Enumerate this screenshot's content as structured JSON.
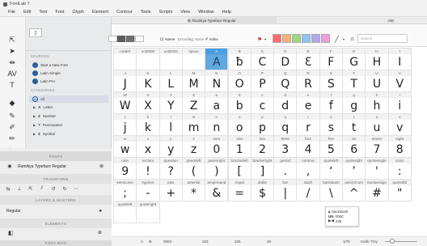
{
  "window": {
    "title": "FontLab 7"
  },
  "menu": [
    "File",
    "Edit",
    "Text",
    "Font",
    "Glyph",
    "Element",
    "Contour",
    "Tools",
    "Scripts",
    "View",
    "Window",
    "Help"
  ],
  "tabs": {
    "dashboard": "Dashboard",
    "font": "Rumikya Typeface Regular",
    "right": "≡/⊟"
  },
  "toolbar": {
    "name_btn": "Name",
    "encoding": "Encoding: None",
    "index_btn": "Index",
    "search_placeholder": "Search"
  },
  "swatches": [
    "#ff6a6a",
    "#ffb07a",
    "#9fd67f",
    "#8fc6ef",
    "#b0a8f2",
    "#f19be0"
  ],
  "panel": {
    "sources_header": "SOURCES",
    "sources": [
      "Start a New Font",
      "Latin Simple",
      "Latin Pro"
    ],
    "categories_header": "CATEGORIES",
    "all_label": "All",
    "categories": [
      {
        "icon": "A",
        "label": "Letter"
      },
      {
        "icon": "2",
        "label": "Number"
      },
      {
        "icon": "?",
        "label": "Punctuation"
      },
      {
        "icon": "Σ",
        "label": "Symbol"
      }
    ]
  },
  "lower": {
    "fonts_header": "FONTS",
    "font_name": "Rumikya Typeface Regular",
    "transform_header": "TRANSFORM",
    "layers_header": "LAYERS & MASTERS",
    "layer_name": "Regular",
    "elements_header": "ELEMENTS",
    "font_info_header": "FONT INFO"
  },
  "grid": {
    "rows": [
      {
        "names": [
          "notdef",
          "uni0000",
          "uni000D",
          "space",
          "A",
          "B",
          "C",
          "D",
          "E",
          "F",
          "G",
          "H",
          "I"
        ],
        "glyphs": [
          "",
          "",
          "",
          "",
          "A",
          "ƀ",
          "С",
          "D",
          "Ɛ",
          "F",
          "G",
          "H",
          "I"
        ]
      },
      {
        "names": [
          "J",
          "K",
          "L",
          "M",
          "N",
          "O",
          "P",
          "Q",
          "R",
          "S",
          "T",
          "U",
          "V"
        ],
        "glyphs": [
          "J",
          "K",
          "L",
          "M",
          "N",
          "O",
          "P",
          "Q",
          "R",
          "S",
          "T",
          "U",
          "V"
        ]
      },
      {
        "names": [
          "W",
          "X",
          "Y",
          "Z",
          "a",
          "b",
          "c",
          "d",
          "e",
          "f",
          "g",
          "h",
          "i"
        ],
        "glyphs": [
          "W",
          "X",
          "Y",
          "Z",
          "a",
          "b",
          "c",
          "d",
          "e",
          "f",
          "g",
          "h",
          "i"
        ]
      },
      {
        "names": [
          "j",
          "k",
          "l",
          "m",
          "n",
          "o",
          "p",
          "q",
          "r",
          "s",
          "t",
          "u",
          "v"
        ],
        "glyphs": [
          "j",
          "k",
          "l",
          "m",
          "n",
          "o",
          "p",
          "q",
          "r",
          "s",
          "t",
          "u",
          "v"
        ]
      },
      {
        "names": [
          "w",
          "x",
          "y",
          "z",
          "zero",
          "one",
          "two",
          "three",
          "four",
          "five",
          "six",
          "seven",
          "eight"
        ],
        "glyphs": [
          "w",
          "x",
          "y",
          "z",
          "0",
          "1",
          "2",
          "3",
          "4",
          "5",
          "6",
          "7",
          "8"
        ]
      },
      {
        "names": [
          "nine",
          "exclam",
          "question",
          "parenleft",
          "parenright",
          "bracketleft",
          "bracketright",
          "period",
          "comma",
          "quoteleft",
          "quoteright",
          "quotesingle",
          "colon"
        ],
        "glyphs": [
          "9",
          "!",
          "?",
          "(",
          ")",
          "[",
          "]",
          ".",
          ",",
          "‘",
          "’",
          "'",
          ":"
        ]
      },
      {
        "names": [
          "semicolon",
          "hyphen",
          "plus",
          "asterisk",
          "ampersand",
          "equal",
          "dollar",
          "bar",
          "slash",
          "backslash",
          "asciicircum",
          "numbersign",
          "quotedbl"
        ],
        "glyphs": [
          ";",
          "-",
          "+",
          "*",
          "&",
          "=",
          "$",
          "|",
          "/",
          "\\",
          "^",
          "#",
          "\""
        ]
      },
      {
        "names": [
          "quoteleft",
          "quoteright"
        ],
        "glyphs": [
          "",
          ""
        ]
      }
    ],
    "selected": "A"
  },
  "tooltip": {
    "name": "backslash",
    "unicode": "005C",
    "index": "235"
  },
  "status": {
    "glyph": "A",
    "index": "0003",
    "w": "323",
    "val1": "425",
    "val2": "25",
    "count": "1/75",
    "cells": "Cells: Tiny"
  }
}
